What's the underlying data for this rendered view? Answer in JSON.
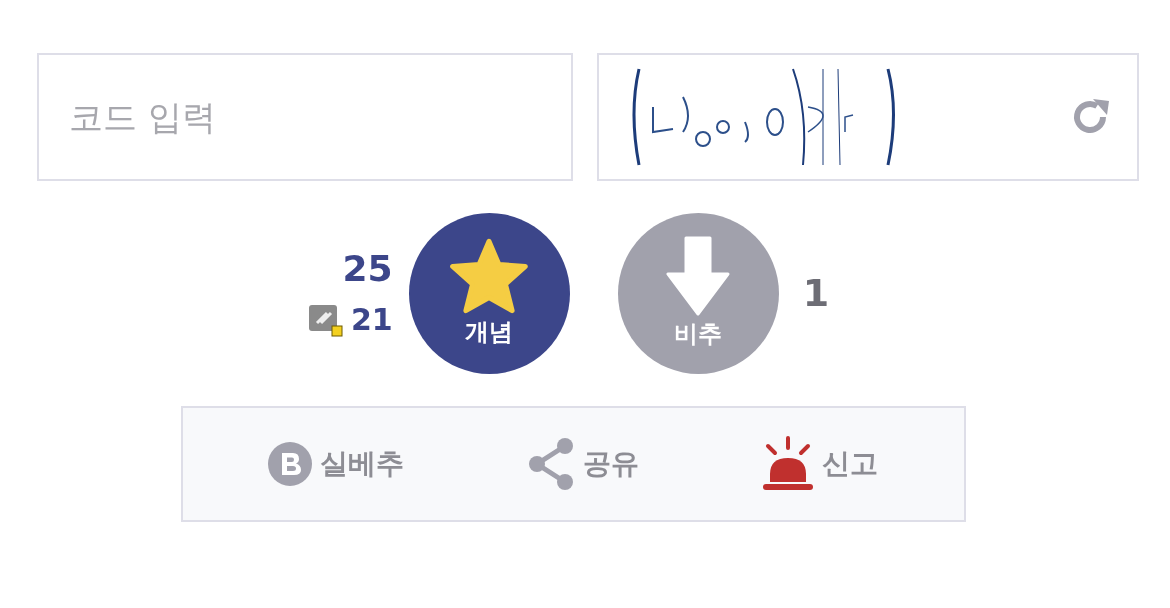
{
  "code_field": {
    "placeholder": "코드 입력"
  },
  "vote": {
    "up_count": "25",
    "fixed_count": "21",
    "up_label": "개념",
    "down_label": "비추",
    "down_count": "1"
  },
  "actions": [
    {
      "kind": "best",
      "label": "실베추"
    },
    {
      "kind": "share",
      "label": "공유"
    },
    {
      "kind": "report",
      "label": "신고"
    }
  ]
}
